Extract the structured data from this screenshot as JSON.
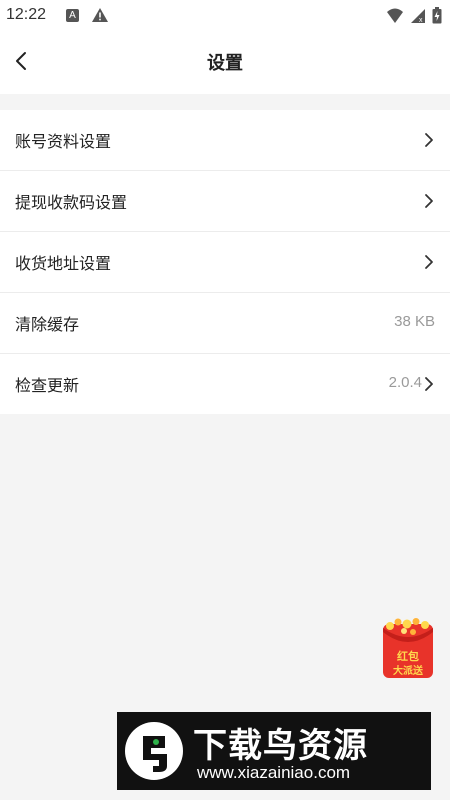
{
  "status_bar": {
    "time": "12:22",
    "a_badge": "A"
  },
  "header": {
    "title": "设置"
  },
  "settings": [
    {
      "label": "账号资料设置",
      "value": "",
      "chevron": true
    },
    {
      "label": "提现收款码设置",
      "value": "",
      "chevron": true
    },
    {
      "label": "收货地址设置",
      "value": "",
      "chevron": true
    },
    {
      "label": "清除缓存",
      "value": "38 KB",
      "chevron": false
    },
    {
      "label": "检查更新",
      "value": "2.0.4",
      "chevron": true
    }
  ],
  "promo": {
    "line1": "红包",
    "line2": "大派送"
  },
  "watermark": {
    "title": "下载鸟资源",
    "url": "www.xiazainiao.com"
  },
  "colors": {
    "background": "#f4f4f4",
    "promo_red": "#e8332a",
    "promo_gold": "#ffd84d",
    "watermark_bg": "#111111"
  }
}
